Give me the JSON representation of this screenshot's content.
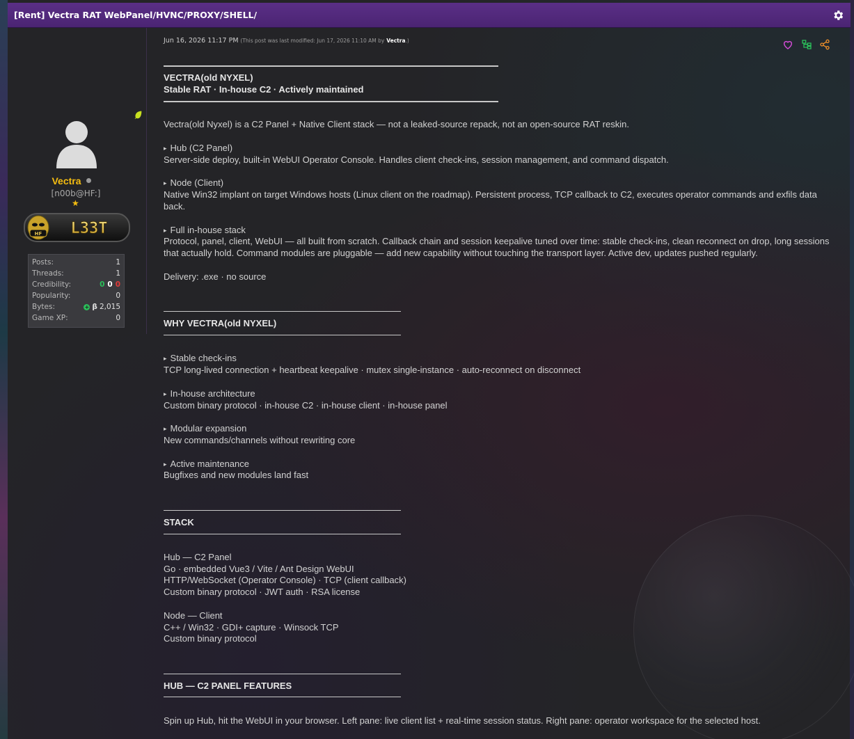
{
  "thread": {
    "title": "[Rent] Vectra RAT WebPanel/HVNC/PROXY/SHELL/"
  },
  "author": {
    "username": "Vectra",
    "usertitle": "[n00b@HF:]",
    "badge_text": "L33T",
    "badge_logo": "HF",
    "stats": {
      "posts_label": "Posts:",
      "posts": "1",
      "threads_label": "Threads:",
      "threads": "1",
      "credibility_label": "Credibility:",
      "cred_pos": "0",
      "cred_neu": "0",
      "cred_neg": "0",
      "popularity_label": "Popularity:",
      "popularity": "0",
      "bytes_label": "Bytes:",
      "bytes_symbol": "β",
      "bytes": "2,015",
      "gamexp_label": "Game XP:",
      "gamexp": "0"
    }
  },
  "post": {
    "date": "Jun 16, 2026 11:17 PM",
    "edited_prefix": "(This post was last modified: Jun 17, 2026 11:10 AM by",
    "edited_by": "Vectra",
    "edited_suffix": ".)",
    "header_line1": "VECTRA(old NYXEL)",
    "header_line2": "Stable RAT · In-house C2 · Actively maintained",
    "intro": "Vectra(old Nyxel) is a C2 Panel + Native Client stack — not a leaked-source repack, not an open-source RAT reskin.",
    "hub_title": "Hub (C2 Panel)",
    "hub_text": "Server-side deploy, built-in WebUI Operator Console. Handles client check-ins, session management, and command dispatch.",
    "node_title": "Node (Client)",
    "node_text": "Native Win32 implant on target Windows hosts (Linux client on the roadmap). Persistent process, TCP callback to C2, executes operator commands and exfils data back.",
    "stack_title": "Full in-house stack",
    "stack_text": "Protocol, panel, client, WebUI — all built from scratch. Callback chain and session keepalive tuned over time: stable check-ins, clean reconnect on drop, long sessions that actually hold. Command modules are pluggable — add new capability without touching the transport layer. Active dev, updates pushed regularly.",
    "delivery": "Delivery: .exe · no source",
    "why_header": "WHY VECTRA(old NYXEL)",
    "why_items": [
      {
        "title": "Stable check-ins",
        "text": "TCP long-lived connection + heartbeat keepalive · mutex single-instance · auto-reconnect on disconnect"
      },
      {
        "title": "In-house architecture",
        "text": "Custom binary protocol · in-house C2 · in-house client · in-house panel"
      },
      {
        "title": "Modular expansion",
        "text": "New commands/channels without rewriting core"
      },
      {
        "title": "Active maintenance",
        "text": "Bugfixes and new modules land fast"
      }
    ],
    "stack_header": "STACK",
    "hub_stack": [
      "Hub — C2 Panel",
      "Go · embedded Vue3 / Vite / Ant Design WebUI",
      "HTTP/WebSocket (Operator Console) · TCP (client callback)",
      "Custom binary protocol · JWT auth · RSA license"
    ],
    "node_stack": [
      "Node — Client",
      "C++ / Win32 · GDI+ capture · Winsock TCP",
      "Custom binary protocol"
    ],
    "features_header": "HUB — C2 PANEL FEATURES",
    "features_intro": "Spin up Hub, hit the WebUI in your browser. Left pane: live client list + real-time session status. Right pane: operator workspace for the selected host."
  },
  "colors": {
    "header_bg": "#5a2f86",
    "username": "#f5bd11",
    "cred_positive": "#2bbf5a",
    "cred_negative": "#e03a3a",
    "like": "#d14bd6",
    "thread_tree": "#2bbf5a",
    "share": "#f0902a"
  },
  "icons": [
    "gear-icon",
    "leaf-icon",
    "avatar-placeholder",
    "heart-icon",
    "thread-tree-icon",
    "share-icon",
    "star-icon",
    "online-status-icon"
  ]
}
